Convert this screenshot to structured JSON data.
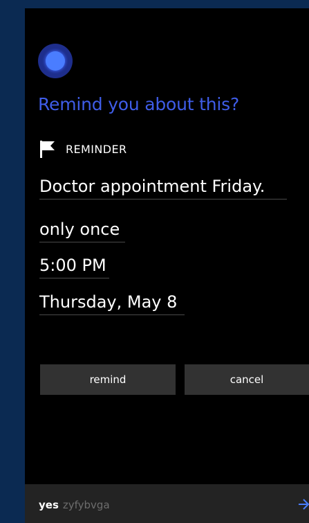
{
  "cortana": {
    "prompt": "Remind you about this?"
  },
  "reminder": {
    "type_label": "REMINDER",
    "type_icon": "flag-icon",
    "title": "Doctor appointment Friday.",
    "repeat": "only once",
    "time": "5:00 PM",
    "date": "Thursday, May 8"
  },
  "actions": {
    "remind_label": "remind",
    "cancel_label": "cancel"
  },
  "speech": {
    "recognized": "yes",
    "interim": "zyfybvga",
    "submit_icon": "arrow-right-icon"
  },
  "colors": {
    "accent": "#3f5de8",
    "orb_outer": "#1e2e8c",
    "orb_inner": "#4a7dff",
    "frame": "#0b2a52",
    "button": "#323232",
    "bar": "#232323"
  }
}
